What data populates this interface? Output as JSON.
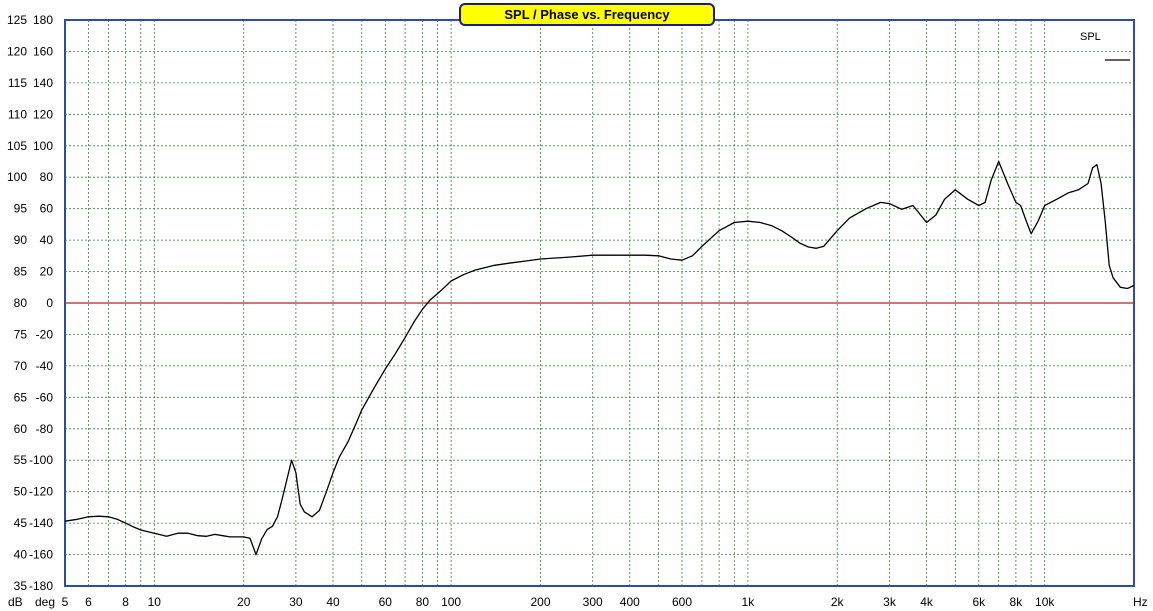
{
  "chart_data": {
    "type": "line",
    "title": "SPL / Phase vs. Frequency",
    "x_scale": "log",
    "xlim": [
      5,
      20000
    ],
    "ylim": [
      35,
      125
    ],
    "ylim_phase": [
      -180,
      180
    ],
    "y_unit_label": "dB",
    "phase_unit_label": "deg",
    "x_unit_label": "Hz",
    "x_ticks": [
      {
        "value": 5,
        "label": "5"
      },
      {
        "value": 6,
        "label": "6"
      },
      {
        "value": 8,
        "label": "8"
      },
      {
        "value": 10,
        "label": "10"
      },
      {
        "value": 20,
        "label": "20"
      },
      {
        "value": 30,
        "label": "30"
      },
      {
        "value": 40,
        "label": "40"
      },
      {
        "value": 60,
        "label": "60"
      },
      {
        "value": 80,
        "label": "80"
      },
      {
        "value": 100,
        "label": "100"
      },
      {
        "value": 200,
        "label": "200"
      },
      {
        "value": 300,
        "label": "300"
      },
      {
        "value": 400,
        "label": "400"
      },
      {
        "value": 600,
        "label": "600"
      },
      {
        "value": 1000,
        "label": "1k"
      },
      {
        "value": 2000,
        "label": "2k"
      },
      {
        "value": 3000,
        "label": "3k"
      },
      {
        "value": 4000,
        "label": "4k"
      },
      {
        "value": 6000,
        "label": "6k"
      },
      {
        "value": 8000,
        "label": "8k"
      },
      {
        "value": 10000,
        "label": "10k"
      }
    ],
    "y_ticks_db": [
      "125",
      "120",
      "115",
      "110",
      "105",
      "100",
      "95",
      "90",
      "85",
      "80",
      "75",
      "70",
      "65",
      "60",
      "55",
      "50",
      "45",
      "40",
      "35"
    ],
    "y_ticks_phase": [
      "180",
      "160",
      "140",
      "120",
      "100",
      "80",
      "60",
      "40",
      "20",
      "0",
      "-20",
      "-40",
      "-60",
      "-80",
      "-100",
      "-120",
      "-140",
      "-160",
      "-180"
    ],
    "grid": true,
    "legend_position": "top-right",
    "colors": {
      "background": "#ffffff",
      "grid": "#2e8b2e",
      "frame": "#2a4ab5",
      "series": "#000000",
      "reference_line": "#b42020",
      "title_box_fill": "#ffff00",
      "title_box_border": "#1a1aa0"
    },
    "reference_line_y": 80,
    "series": [
      {
        "name": "SPL",
        "x": [
          5,
          5.5,
          6,
          6.5,
          7,
          7.5,
          8,
          8.5,
          9,
          10,
          11,
          12,
          13,
          14,
          15,
          16,
          17,
          18,
          20,
          21,
          22,
          23,
          24,
          25,
          26,
          27,
          28,
          29,
          30,
          31,
          32,
          34,
          36,
          38,
          40,
          42,
          45,
          48,
          50,
          55,
          60,
          65,
          70,
          75,
          80,
          85,
          90,
          95,
          100,
          110,
          120,
          140,
          160,
          180,
          200,
          250,
          300,
          350,
          400,
          450,
          500,
          550,
          600,
          650,
          700,
          800,
          900,
          1000,
          1100,
          1200,
          1300,
          1400,
          1500,
          1600,
          1700,
          1800,
          2000,
          2200,
          2500,
          2800,
          3000,
          3300,
          3600,
          4000,
          4300,
          4600,
          5000,
          5500,
          6000,
          6300,
          6600,
          7000,
          7500,
          8000,
          8300,
          8600,
          9000,
          9500,
          10000,
          11000,
          12000,
          13000,
          14000,
          14500,
          15000,
          15500,
          16000,
          16500,
          17000,
          18000,
          19000,
          20000
        ],
        "values": [
          45.3,
          45.6,
          46.0,
          46.1,
          46.0,
          45.6,
          45.0,
          44.4,
          43.9,
          43.4,
          42.9,
          43.4,
          43.4,
          43.0,
          42.9,
          43.2,
          43.0,
          42.8,
          42.8,
          42.6,
          40.0,
          42.5,
          44.0,
          44.5,
          46.0,
          49.0,
          52.0,
          55.0,
          53.0,
          48.0,
          46.8,
          46.0,
          47.0,
          50.0,
          53.0,
          55.5,
          58.0,
          61.0,
          63.0,
          66.5,
          69.5,
          72.0,
          74.5,
          77.0,
          79.0,
          80.5,
          81.5,
          82.5,
          83.5,
          84.5,
          85.2,
          86.0,
          86.4,
          86.7,
          87.0,
          87.3,
          87.6,
          87.6,
          87.6,
          87.6,
          87.5,
          87.0,
          86.8,
          87.5,
          89.0,
          91.5,
          92.8,
          93.0,
          92.8,
          92.3,
          91.5,
          90.5,
          89.5,
          88.9,
          88.7,
          89.0,
          91.5,
          93.5,
          95.0,
          96.0,
          95.8,
          94.9,
          95.5,
          92.8,
          94.0,
          96.5,
          98.0,
          96.5,
          95.5,
          96.0,
          99.5,
          102.5,
          99.0,
          96.0,
          95.5,
          93.5,
          91.0,
          93.0,
          95.5,
          96.5,
          97.5,
          98.0,
          99.0,
          101.5,
          102.0,
          99.0,
          93.0,
          86.0,
          84.0,
          82.5,
          82.3,
          82.8
        ]
      }
    ]
  }
}
